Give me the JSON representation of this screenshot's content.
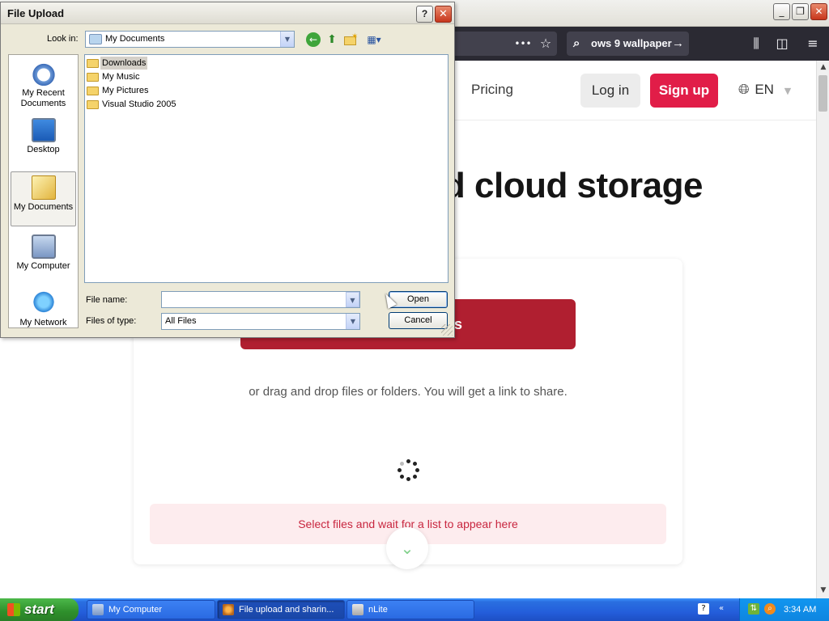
{
  "browser": {
    "toolbar": {
      "more_label": "•••",
      "search_text": "ows 9 wallpaper",
      "library_icon": "library-icon",
      "sidebar_icon": "sidebar-icon",
      "menu_icon": "hamburger-menu-icon"
    },
    "window_buttons": {
      "minimize": "_",
      "restore": "❐",
      "close": "✕"
    }
  },
  "page": {
    "nav": {
      "pricing": "Pricing",
      "login": "Log in",
      "signup": "Sign up",
      "language": "EN"
    },
    "hero_title": "d cloud storage",
    "upload_button": "s",
    "drag_hint": "or drag and drop files or folders. You will get a link to share.",
    "list_hint": "Select files and wait for a list to appear here",
    "accent_color": "#e11d48"
  },
  "dialog": {
    "title": "File Upload",
    "help": "?",
    "close": "✕",
    "look_in_label": "Look in:",
    "look_in_value": "My Documents",
    "places": [
      {
        "label": "My Recent Documents",
        "icon": "recent-documents-icon"
      },
      {
        "label": "Desktop",
        "icon": "desktop-icon"
      },
      {
        "label": "My Documents",
        "icon": "my-documents-icon",
        "selected": true
      },
      {
        "label": "My Computer",
        "icon": "my-computer-icon"
      },
      {
        "label": "My Network",
        "icon": "my-network-icon"
      }
    ],
    "files": [
      {
        "name": "Downloads",
        "selected": true
      },
      {
        "name": "My Music"
      },
      {
        "name": "My Pictures"
      },
      {
        "name": "Visual Studio 2005"
      }
    ],
    "file_name_label": "File name:",
    "file_name_value": "",
    "files_of_type_label": "Files of type:",
    "files_of_type_value": "All Files",
    "open_label": "Open",
    "cancel_label": "Cancel"
  },
  "taskbar": {
    "start_label": "start",
    "tasks": [
      {
        "label": "My Computer"
      },
      {
        "label": "File upload and sharin..."
      },
      {
        "label": "nLite"
      }
    ],
    "clock": "3:34 AM"
  }
}
